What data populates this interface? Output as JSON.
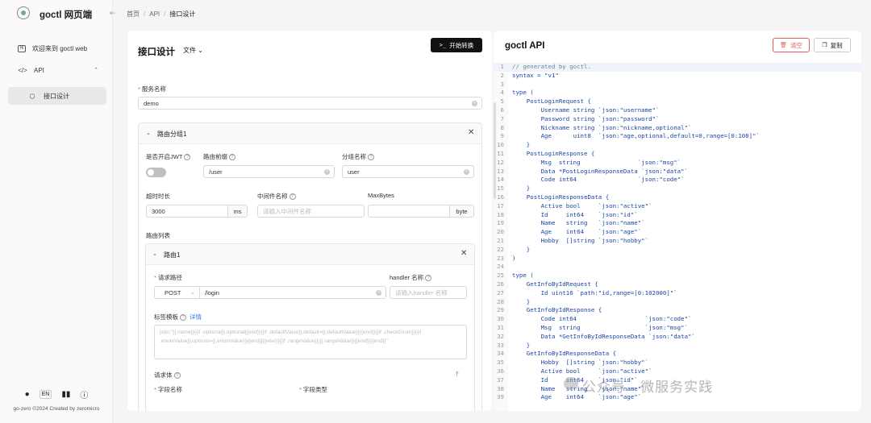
{
  "app": {
    "title": "goctl 网页端",
    "copyright": "go-zero ©2024 Created by zeromicro",
    "lang": "EN"
  },
  "sidebar": {
    "items": [
      {
        "label": "欢迎来到 goctl web"
      },
      {
        "label": "API"
      },
      {
        "label": "接口设计"
      }
    ]
  },
  "breadcrumb": [
    "首页",
    "API",
    "接口设计"
  ],
  "left": {
    "title": "接口设计",
    "file_menu": "文件",
    "generate_button": "开始转换",
    "service_label": "服务名称",
    "service_value": "demo",
    "group": {
      "title": "路由分组1",
      "jwt_label": "是否开启JWT",
      "prefix_label": "路由前缀",
      "prefix_value": "/user",
      "group_label": "分组名称",
      "group_value": "user",
      "timeout_label": "超时时长",
      "timeout_value": "3000",
      "timeout_unit": "ms",
      "middleware_label": "中间件名称",
      "middleware_placeholder": "请输入中间件名称",
      "maxbytes_label": "MaxBytes",
      "maxbytes_unit": "byte",
      "routes_label": "路由列表",
      "route": {
        "title": "路由1",
        "path_label": "请求路径",
        "method": "POST",
        "path_value": "/login",
        "handler_label": "handler 名称",
        "handler_placeholder": "请输入handler 名称",
        "tag_label": "标签模板",
        "tag_link": "详情",
        "tag_placeholder": "json:\"{{.name}}{{if .optional}},optional{{end}}{{if .defaultValue}},default={{.defaultValue}}{{end}}{{if .checkEnum}}{{if .enumValue}},options={{.enumValue}}{{end}}{{else}}{{if .rangeValue}},{{.rangeValue}}{{end}}{{end}}\"",
        "body_label": "请求体",
        "field_name_label": "字段名称",
        "field_type_label": "字段类型"
      }
    }
  },
  "right": {
    "title": "goctl API",
    "clear_button": "清空",
    "copy_button": "复制",
    "code_lines": [
      "// generated by goctl.",
      "syntax = \"v1\"",
      "",
      "type (",
      "    PostLoginRequest {",
      "        Username string `json:\"username\"`",
      "        Password string `json:\"password\"`",
      "        Nickname string `json:\"nickname,optional\"`",
      "        Age      uint8  `json:\"age,optional,default=0,range=[0:100]\"`",
      "    }",
      "    PostLoginResponse {",
      "        Msg  string                `json:\"msg\"`",
      "        Data *PostLoginResponseData `json:\"data\"`",
      "        Code int64                 `json:\"code\"`",
      "    }",
      "    PostLoginResponseData {",
      "        Active bool     `json:\"active\"`",
      "        Id     int64    `json:\"id\"`",
      "        Name   string   `json:\"name\"`",
      "        Age    int64    `json:\"age\"`",
      "        Hobby  []string `json:\"hobby\"`",
      "    }",
      ")",
      "",
      "type (",
      "    GetInfoByIdRequest {",
      "        Id uint16 `path:\"id,range=[0:102000]\"`",
      "    }",
      "    GetInfoByIdResponse {",
      "        Code int64                   `json:\"code\"`",
      "        Msg  string                  `json:\"msg\"`",
      "        Data *GetInfoByIdResponseData `json:\"data\"`",
      "    }",
      "    GetInfoByIdResponseData {",
      "        Hobby  []string `json:\"hobby\"`",
      "        Active bool     `json:\"active\"`",
      "        Id     int64    `json:\"id\"`",
      "        Name   string   `json:\"name\"`",
      "        Age    int64    `json:\"age\"`"
    ]
  },
  "watermark": "公众号 · 微服务实践",
  "colors": {
    "accent": "#2f7ae5",
    "danger": "#e35d5d",
    "code": "#1a46a8"
  }
}
